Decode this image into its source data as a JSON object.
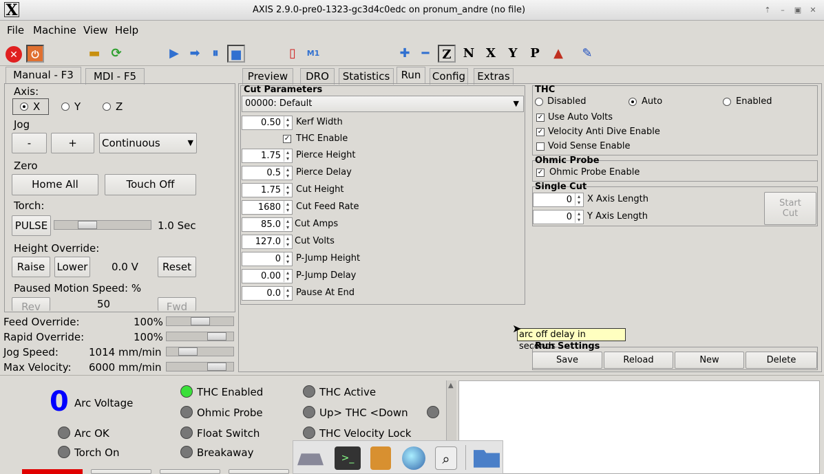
{
  "window": {
    "title": "AXIS 2.9.0-pre0-1323-gc3d4c0edc on pronum_andre (no file)"
  },
  "menu": [
    "File",
    "Machine",
    "View",
    "Help"
  ],
  "left_tabs": [
    "Manual - F3",
    "MDI - F5"
  ],
  "manual": {
    "axis_label": "Axis:",
    "axes": [
      "X",
      "Y",
      "Z"
    ],
    "jog_label": "Jog",
    "jog_minus": "-",
    "jog_plus": "+",
    "jog_mode": "Continuous",
    "zero_label": "Zero",
    "home_all": "Home All",
    "touch_off": "Touch Off",
    "torch_label": "Torch:",
    "pulse": "PULSE",
    "pulse_time": "1.0 Sec",
    "pulse_value": 0.3,
    "height_override_label": "Height Override:",
    "raise": "Raise",
    "lower": "Lower",
    "height_value": "0.0 V",
    "reset": "Reset",
    "paused_label": "Paused Motion Speed: %",
    "rev": "Rev",
    "paused_value": "50",
    "fwd": "Fwd"
  },
  "overrides": [
    {
      "label": "Feed Override:",
      "value": "100",
      "unit": "%",
      "level": 0.5
    },
    {
      "label": "Rapid Override:",
      "value": "100",
      "unit": "%",
      "level": 0.85
    },
    {
      "label": "Jog Speed:",
      "value": "1014",
      "unit": "mm/min",
      "level": 0.25
    },
    {
      "label": "Max Velocity:",
      "value": "6000",
      "unit": "mm/min",
      "level": 0.85
    }
  ],
  "right_tabs": [
    "Preview",
    "DRO",
    "Statistics",
    "Run",
    "Config",
    "Extras"
  ],
  "cut": {
    "header": "Cut Parameters",
    "material": "00000: Default",
    "rows": [
      {
        "value": "0.50",
        "label": "Kerf Width"
      },
      {
        "label": "THC Enable",
        "checked": true
      },
      {
        "value": "1.75",
        "label": "Pierce Height"
      },
      {
        "value": "0.5",
        "label": "Pierce Delay"
      },
      {
        "value": "1.75",
        "label": "Cut Height"
      },
      {
        "value": "1680",
        "label": "Cut Feed Rate"
      },
      {
        "value": "85.0",
        "label": "Cut Amps"
      },
      {
        "value": "127.0",
        "label": "Cut Volts"
      },
      {
        "value": "0",
        "label": "P-Jump Height"
      },
      {
        "value": "0.00",
        "label": "P-Jump Delay"
      },
      {
        "value": "0.0",
        "label": "Pause At End"
      }
    ]
  },
  "thc": {
    "header": "THC",
    "modes": [
      "Disabled",
      "Auto",
      "Enabled"
    ],
    "options": [
      {
        "label": "Use Auto Volts",
        "checked": true
      },
      {
        "label": "Velocity Anti Dive Enable",
        "checked": true
      },
      {
        "label": "Void Sense Enable",
        "checked": false
      }
    ]
  },
  "ohmic": {
    "header": "Ohmic Probe",
    "label": "Ohmic Probe Enable",
    "checked": true
  },
  "single_cut": {
    "header": "Single Cut",
    "x_value": "0",
    "x_label": "X Axis Length",
    "y_value": "0",
    "y_label": "Y Axis Length",
    "start_line1": "Start",
    "start_line2": "Cut"
  },
  "tooltip": "arc off delay in seconds",
  "run_settings": {
    "header": "Run Settings",
    "buttons": [
      "Save",
      "Reload",
      "New",
      "Delete"
    ]
  },
  "status": {
    "arc_value": "0",
    "arc_label": "Arc Voltage",
    "indicators": [
      "THC Enabled",
      "Ohmic Probe",
      "Arc OK",
      "Float Switch",
      "Torch On",
      "Breakaway",
      "THC Active",
      "Up> THC <Down",
      "THC Velocity Lock"
    ],
    "colors": {
      "on": "#3ae03a",
      "off": "#777777",
      "arc": "#0000ff"
    }
  }
}
